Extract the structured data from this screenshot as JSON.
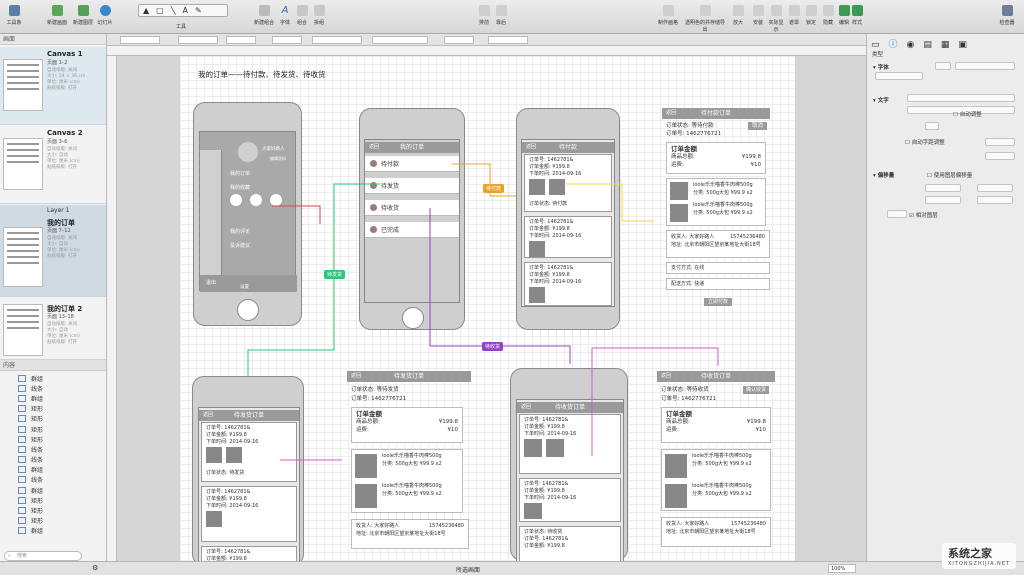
{
  "toolbar": {
    "left_items": [
      "工具条",
      "新建画面",
      "新建图层",
      "幻灯片"
    ],
    "tools_label": "工具",
    "middle_items": [
      "新建组合",
      "字体",
      "组合",
      "拆组"
    ],
    "center_items": [
      "排前",
      "靠后"
    ],
    "right_items": [
      "制作画格",
      "透明色的并存储导出",
      "放大",
      "安装",
      "实际显示",
      "遮罩",
      "锁定",
      "隐藏",
      "编辑",
      "组间",
      "样式"
    ],
    "inspect_label": "检查器"
  },
  "left_panel": {
    "header": "画面",
    "canvases": [
      {
        "title": "Canvas 1",
        "pages": "页面 1–2",
        "meta": [
          "自动排版: 关闭",
          "大小: 24 × 36 cm",
          "单位: 厘米 (cm)",
          "贴纸排版: 打开"
        ]
      },
      {
        "title": "Canvas 2",
        "pages": "页面 3–6",
        "meta": [
          "自动排版: 关闭",
          "大小: 自动",
          "单位: 厘米 (cm)",
          "贴纸排版: 打开"
        ]
      },
      {
        "title": "我的订单",
        "pages": "页面 7–12",
        "layer": "Layer 1",
        "meta": [
          "自动排版: 关闭",
          "大小: 自动",
          "单位: 厘米 (cm)",
          "贴纸排版: 打开"
        ]
      },
      {
        "title": "我的订单 2",
        "pages": "页面 13–18",
        "meta": [
          "自动排版: 关闭",
          "大小: 自动",
          "单位: 厘米 (cm)",
          "贴纸排版: 打开"
        ]
      }
    ],
    "content_header": "内容",
    "layers": [
      "群组",
      "线条",
      "群组",
      "矩形",
      "矩形",
      "矩形",
      "矩形",
      "线条",
      "线条",
      "群组",
      "线条",
      "群组",
      "矩形",
      "矩形",
      "矩形",
      "群组"
    ],
    "search_placeholder": "搜索"
  },
  "right_panel": {
    "section1": "类型",
    "font_label": "字体",
    "text_label": "文字",
    "offset_label": "偏移量",
    "checkbox1": "自动调整",
    "checkbox2": "自动字距调整",
    "checkbox3": "使用图层偏移量",
    "checkbox4": "相对图层"
  },
  "canvas": {
    "heading": "我的订单——待付款、待发货、待收货",
    "phone2": {
      "title": "我的订单",
      "back": "返回",
      "rows": [
        "待付款",
        "待发货",
        "待收货",
        "已完成"
      ]
    },
    "phone1": {
      "user": "大家好路人",
      "sub": "编辑资料",
      "menu": [
        "我的订单",
        "我的收藏",
        "我的评论",
        "投诉建议"
      ],
      "logout": "退出",
      "settings": "设置"
    },
    "phone3": {
      "title": "待付款",
      "back": "返回"
    },
    "pane_pay": {
      "back": "返回",
      "title": "待付款订单",
      "status": "订单状态: 等待付款",
      "cancel_btn": "取消",
      "order_no": "订单号: 1462776721",
      "amount_title": "订单金额",
      "goods_total": "商品总额:",
      "goods_val": "¥199.8",
      "freight": "运费:",
      "freight_val": "¥10",
      "item": "loole乐乐喵香牛肉棒500g",
      "spec": "分类: 500g大包",
      "price": "¥99.9",
      "qty": "x2",
      "receiver": "收货人:",
      "receiver_name": "大家好路人",
      "phone": "15745236480",
      "addr": "地址:",
      "addr_val": "北京市朝阳区望京某地址大街18号",
      "pay": "支付方式:",
      "pay_val": "在线",
      "ship": "配送方式:",
      "ship_val": "快递",
      "pay_btn": "立即付款"
    },
    "order_card": {
      "no": "订单号: 1462781& ",
      "total": "订单金额: ¥199.8",
      "time": "下单时间: 2014-09-16",
      "status": "订单状态:",
      "status_val": "待付款"
    },
    "pane_ship": {
      "back": "返回",
      "title": "待发货订单",
      "status": "订单状态: 等待发货",
      "order_no": "订单号: 1462776721"
    },
    "pane_recv": {
      "back": "返回",
      "title": "待收货订单",
      "status": "订单状态: 等待收货",
      "confirm_btn": "确认收货",
      "order_no": "订单号: 1462776721"
    },
    "phone4": {
      "title": "待发货订单",
      "back": "返回",
      "status": "订单状态:",
      "status_val": "待发货"
    },
    "phone5": {
      "title": "待收货订单",
      "back": "返回",
      "status": "订单状态:",
      "status_val": "待收货"
    },
    "tags": [
      "待付款",
      "待发货",
      "待收货"
    ],
    "tag_colors": [
      "#e8a12b",
      "#2bc67a",
      "#9340c9"
    ]
  },
  "status": {
    "center": "所选画面",
    "zoom": "100%"
  },
  "watermark": {
    "main": "系统之家",
    "url": "XITONGZHIJIA.NET"
  }
}
